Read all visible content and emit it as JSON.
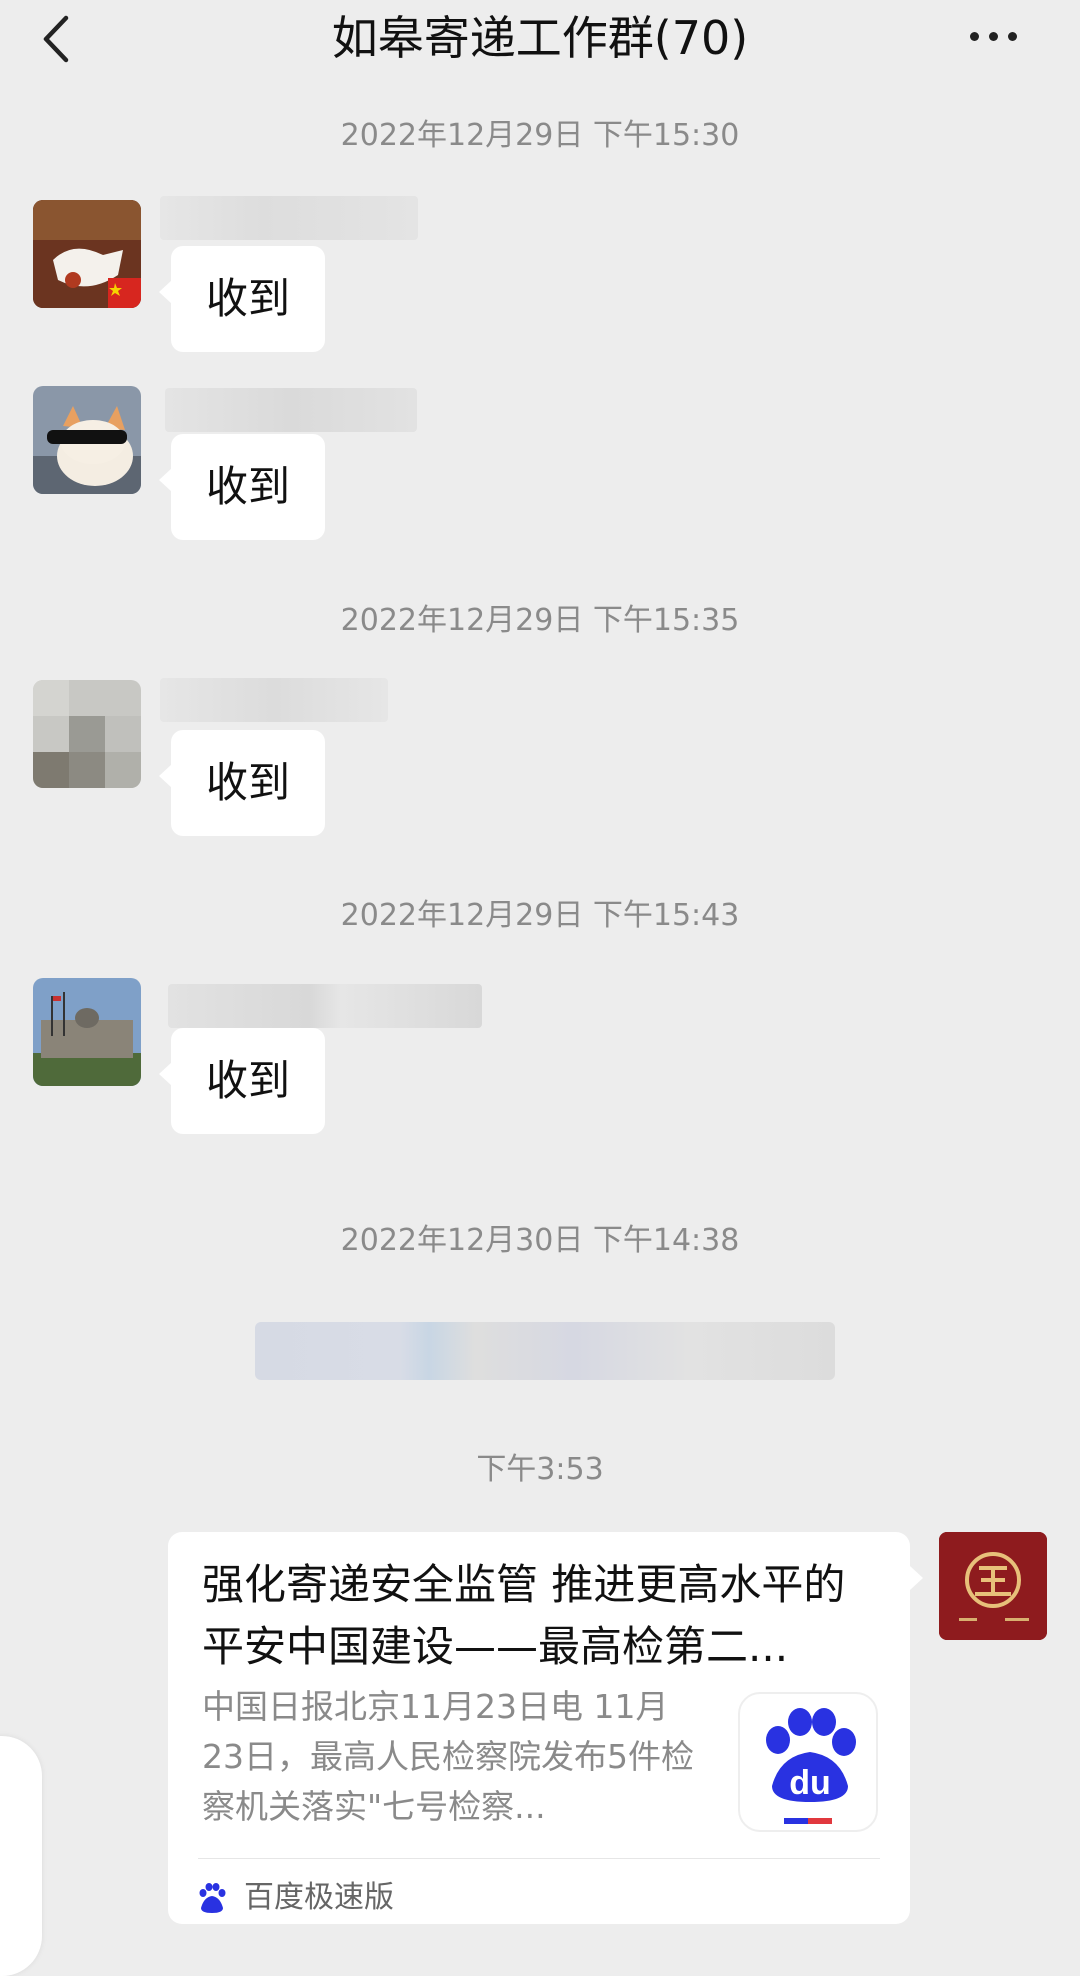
{
  "header": {
    "title": "如皋寄递工作群(70)",
    "back_icon": "chevron-left-icon",
    "more_icon": "ellipsis-icon"
  },
  "timestamps": [
    "2022年12月29日 下午15:30",
    "2022年12月29日 下午15:35",
    "2022年12月29日 下午15:43",
    "2022年12月30日 下午14:38",
    "下午3:53"
  ],
  "messages": [
    {
      "text": "收到"
    },
    {
      "text": "收到"
    },
    {
      "text": "收到"
    },
    {
      "text": "收到"
    }
  ],
  "link_card": {
    "title": "强化寄递安全监管 推进更高水平的平安中国建设——最高检第二...",
    "description": "中国日报北京11月23日电 11月23日，最高人民检察院发布5件检察机关落实\"七号检察...",
    "source": "百度极速版",
    "thumb_icon": "baidu-paw-icon",
    "source_icon": "baidu-paw-icon"
  },
  "colors": {
    "background": "#ededed",
    "bubble": "#ffffff",
    "timestamp": "#8a8a8a",
    "my_avatar": "#8e1b1e",
    "baidu_blue": "#2932e1",
    "baidu_red": "#e1383e"
  }
}
